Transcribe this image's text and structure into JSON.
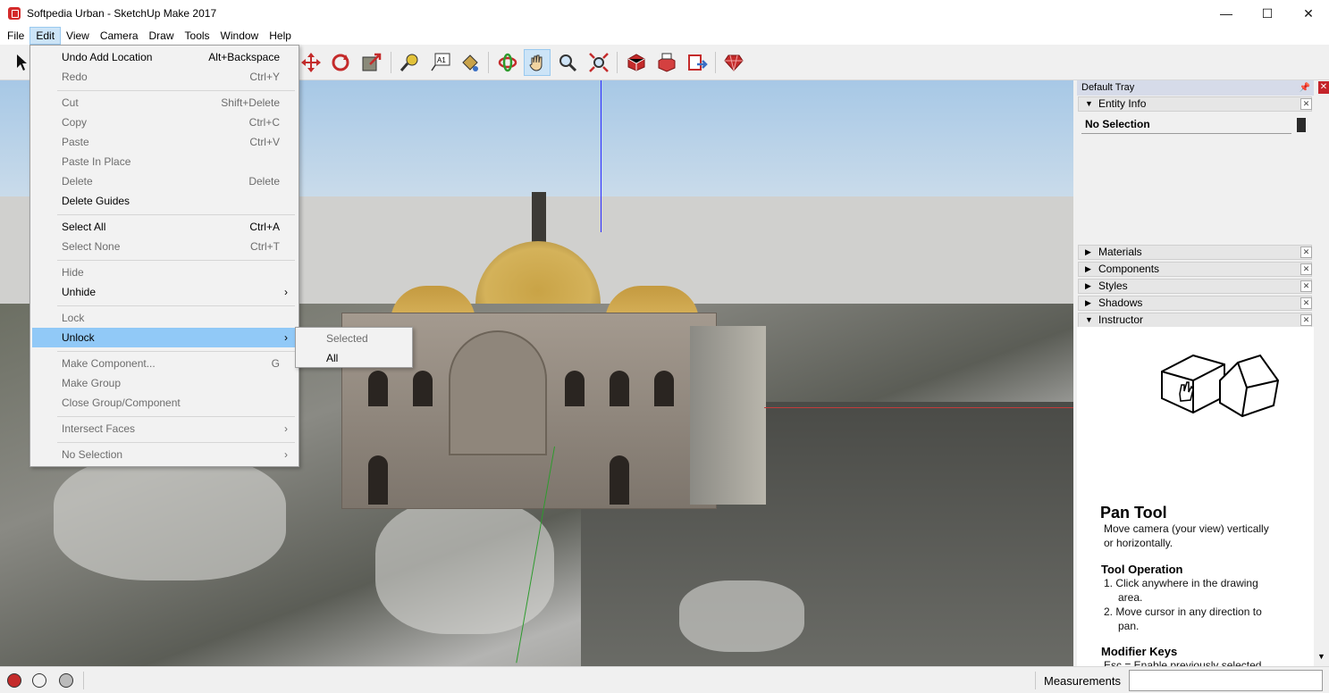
{
  "window": {
    "title": "Softpedia Urban - SketchUp Make 2017",
    "controls": [
      "—",
      "☐",
      "✕"
    ]
  },
  "menubar": [
    "File",
    "Edit",
    "View",
    "Camera",
    "Draw",
    "Tools",
    "Window",
    "Help"
  ],
  "edit_menu": [
    {
      "label": "Undo Add Location",
      "shortcut": "Alt+Backspace",
      "disabled": false
    },
    {
      "label": "Redo",
      "shortcut": "Ctrl+Y",
      "disabled": true
    },
    {
      "label": "Cut",
      "shortcut": "Shift+Delete",
      "disabled": true
    },
    {
      "label": "Copy",
      "shortcut": "Ctrl+C",
      "disabled": true
    },
    {
      "label": "Paste",
      "shortcut": "Ctrl+V",
      "disabled": true
    },
    {
      "label": "Paste In Place",
      "shortcut": "",
      "disabled": true
    },
    {
      "label": "Delete",
      "shortcut": "Delete",
      "disabled": true
    },
    {
      "label": "Delete Guides",
      "shortcut": "",
      "disabled": false
    },
    {
      "label": "Select All",
      "shortcut": "Ctrl+A",
      "disabled": false
    },
    {
      "label": "Select None",
      "shortcut": "Ctrl+T",
      "disabled": true
    },
    {
      "label": "Hide",
      "shortcut": "",
      "disabled": true
    },
    {
      "label": "Unhide",
      "shortcut": "",
      "disabled": false,
      "submenu": true
    },
    {
      "label": "Lock",
      "shortcut": "",
      "disabled": true
    },
    {
      "label": "Unlock",
      "shortcut": "",
      "disabled": false,
      "submenu": true,
      "highlighted": true
    },
    {
      "label": "Make Component...",
      "shortcut": "G",
      "disabled": true
    },
    {
      "label": "Make Group",
      "shortcut": "",
      "disabled": true
    },
    {
      "label": "Close Group/Component",
      "shortcut": "",
      "disabled": true
    },
    {
      "label": "Intersect Faces",
      "shortcut": "",
      "disabled": true,
      "submenu": true
    },
    {
      "label": "No Selection",
      "shortcut": "",
      "disabled": true,
      "submenu": true
    }
  ],
  "unlock_submenu": [
    {
      "label": "Selected",
      "disabled": true
    },
    {
      "label": "All",
      "disabled": false
    }
  ],
  "toolbar_icons": [
    "select-icon",
    "move-icon",
    "rotate-icon",
    "scale-icon",
    "tape-measure-icon",
    "text-icon",
    "paint-bucket-icon",
    "orbit-icon",
    "pan-icon",
    "zoom-icon",
    "zoom-extents-icon",
    "warehouse-icon",
    "share-model-icon",
    "extension-warehouse-icon",
    "ruby-icon"
  ],
  "tray": {
    "title": "Default Tray",
    "entity_info": {
      "label": "Entity Info",
      "selection": "No Selection"
    },
    "panels": [
      "Materials",
      "Components",
      "Styles",
      "Shadows",
      "Instructor"
    ],
    "instructor": {
      "tool_title": "Pan Tool",
      "description_1": "Move camera (your view) vertically",
      "description_2": "or horizontally.",
      "operation_heading": "Tool Operation",
      "step1_a": "1. Click anywhere in the drawing",
      "step1_b": "area.",
      "step2_a": "2. Move cursor in any direction to",
      "step2_b": "pan.",
      "modifier_heading": "Modifier Keys",
      "modifier_text": "Esc = Enable previously selected"
    }
  },
  "statusbar": {
    "measurements_label": "Measurements",
    "measurements_value": ""
  },
  "colors": {
    "menu_highlight": "#91c9f7",
    "active_menu": "#cce4f7",
    "tray_header": "#d6dbe9"
  }
}
